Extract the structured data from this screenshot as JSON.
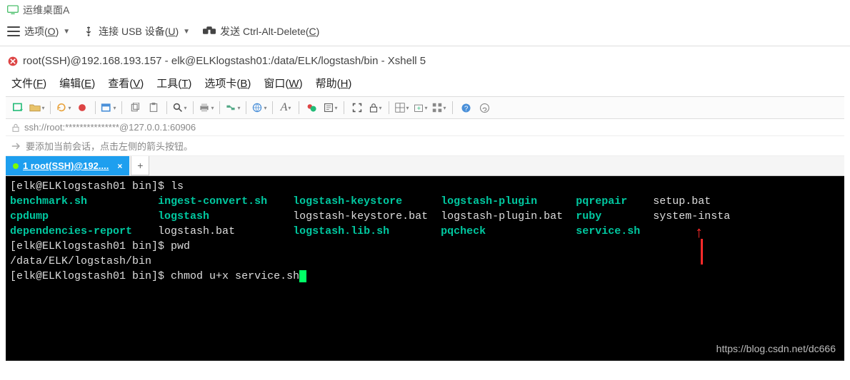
{
  "vm": {
    "title": "运维桌面A"
  },
  "vm_menu": {
    "options": "选项(O)",
    "connect_usb": "连接 USB 设备(U)",
    "send_cad": "发送 Ctrl-Alt-Delete(C)"
  },
  "xshell": {
    "title": "root(SSH)@192.168.193.157 - elk@ELKlogstash01:/data/ELK/logstash/bin - Xshell 5"
  },
  "menu": {
    "file": "文件(F)",
    "edit": "编辑(E)",
    "view": "查看(V)",
    "tools": "工具(T)",
    "tabs": "选项卡(B)",
    "window": "窗口(W)",
    "help": "帮助(H)"
  },
  "addr": {
    "url": "ssh://root:***************@127.0.0.1:60906"
  },
  "hint": {
    "text": "要添加当前会话，点击左侧的箭头按钮。"
  },
  "tab": {
    "label": "1 root(SSH)@192...."
  },
  "term": {
    "line1_prompt": "[elk@ELKlogstash01 bin]$ ",
    "line1_cmd": "ls",
    "row1": {
      "c1": "benchmark.sh",
      "c2": "ingest-convert.sh",
      "c3": "logstash-keystore",
      "c4": "logstash-plugin",
      "c5": "pqrepair",
      "c6": "setup.bat"
    },
    "row2": {
      "c1": "cpdump",
      "c2": "logstash",
      "c3": "logstash-keystore.bat",
      "c4": "logstash-plugin.bat",
      "c5": "ruby",
      "c6": "system-insta"
    },
    "row3": {
      "c1": "dependencies-report",
      "c2": "logstash.bat",
      "c3": "logstash.lib.sh",
      "c4": "pqcheck",
      "c5": "service.sh",
      "c6": ""
    },
    "line_pwd_prompt": "[elk@ELKlogstash01 bin]$ ",
    "line_pwd_cmd": "pwd",
    "pwd_out": "/data/ELK/logstash/bin",
    "line_last_prompt": "[elk@ELKlogstash01 bin]$ ",
    "line_last_cmd": "chmod u+x service.sh"
  },
  "watermark": "https://blog.csdn.net/dc666"
}
